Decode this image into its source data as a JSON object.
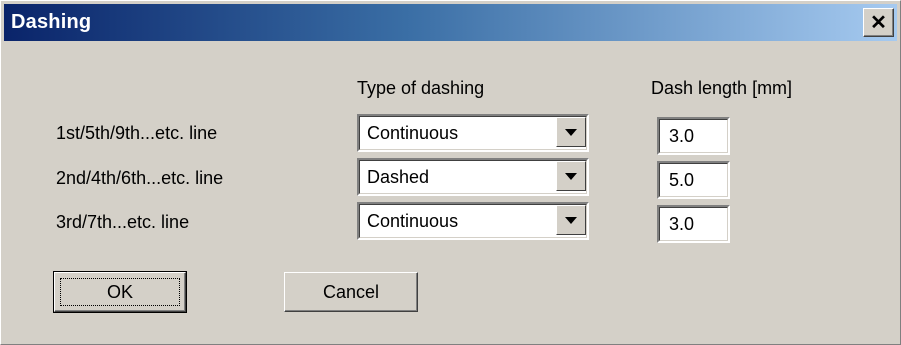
{
  "dialog": {
    "title": "Dashing",
    "close_label": "✕"
  },
  "headers": {
    "type": "Type of dashing",
    "length": "Dash length [mm]"
  },
  "rows": [
    {
      "label": "1st/5th/9th...etc. line",
      "type": "Continuous",
      "length": "3.0"
    },
    {
      "label": "2nd/4th/6th...etc. line",
      "type": "Dashed",
      "length": "5.0"
    },
    {
      "label": "3rd/7th...etc. line",
      "type": "Continuous",
      "length": "3.0"
    }
  ],
  "buttons": {
    "ok": "OK",
    "cancel": "Cancel"
  }
}
